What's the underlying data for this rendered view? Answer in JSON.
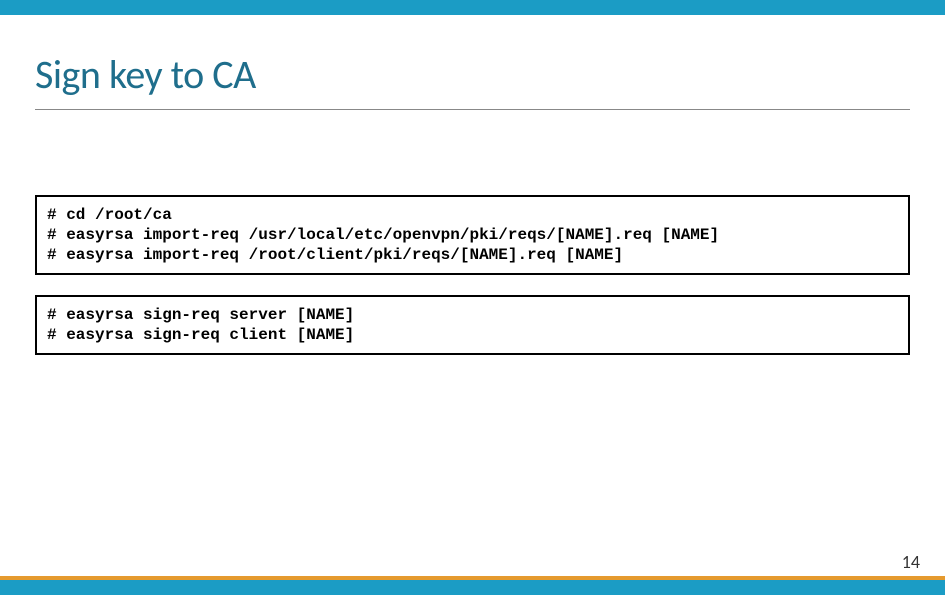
{
  "slide": {
    "title": "Sign key to CA",
    "page_number": "14"
  },
  "code": {
    "block1": "# cd /root/ca\n# easyrsa import-req /usr/local/etc/openvpn/pki/reqs/[NAME].req [NAME]\n# easyrsa import-req /root/client/pki/reqs/[NAME].req [NAME]",
    "block2": "# easyrsa sign-req server [NAME]\n# easyrsa sign-req client [NAME]"
  }
}
